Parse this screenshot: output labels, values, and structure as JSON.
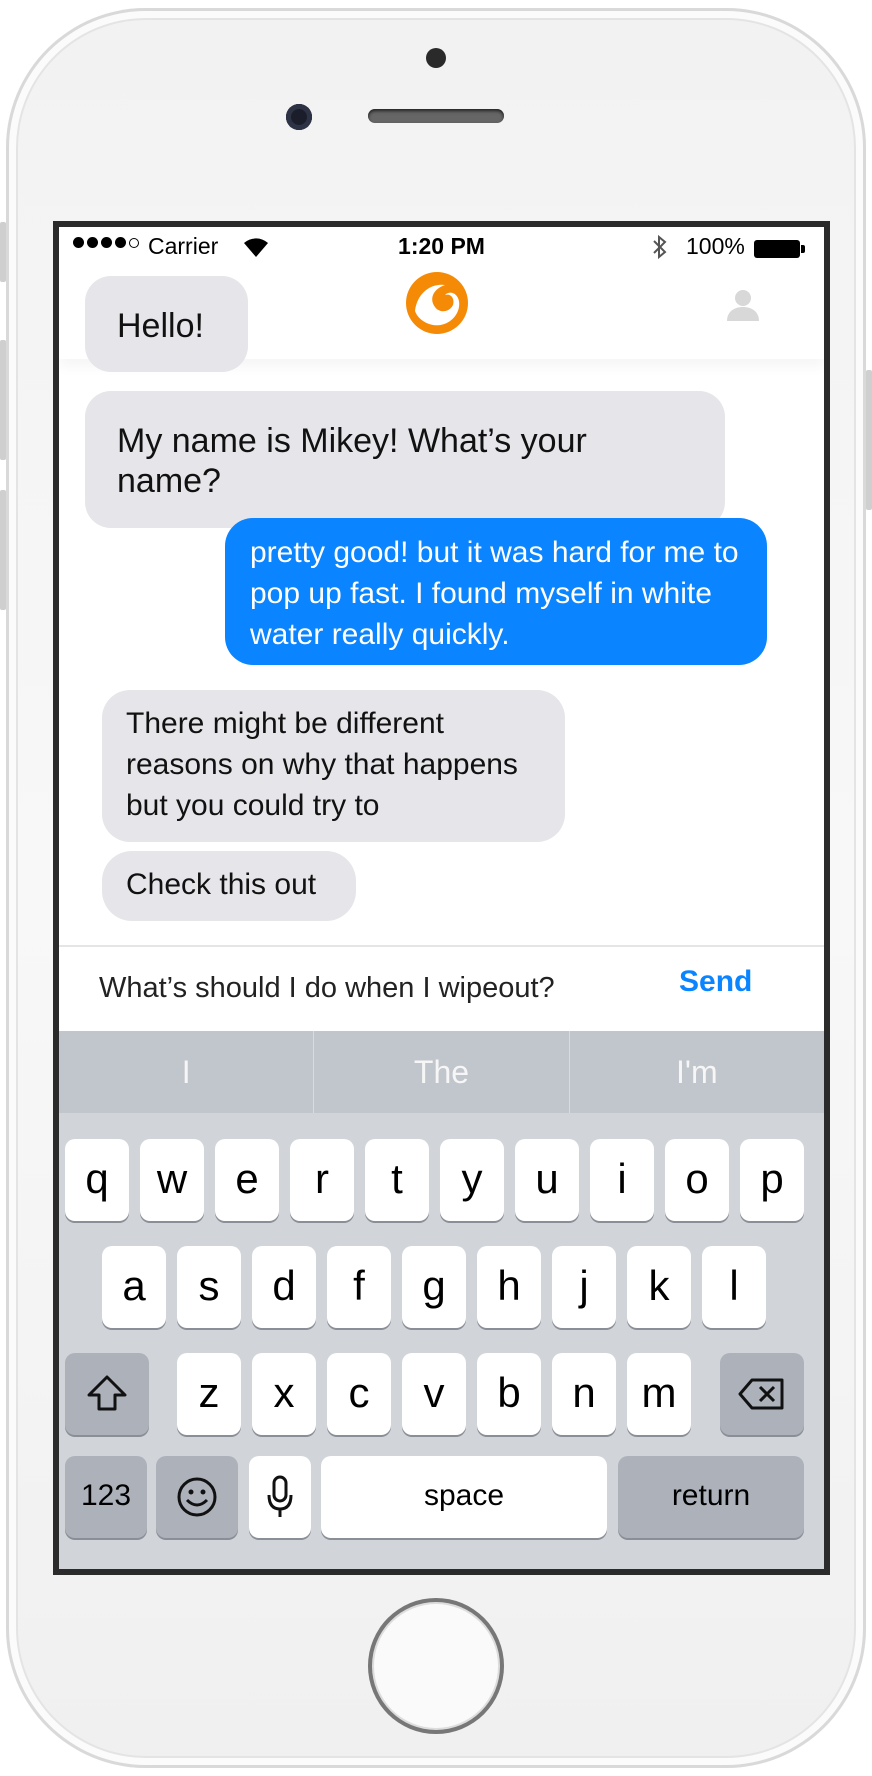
{
  "status_bar": {
    "carrier": "Carrier",
    "time": "1:20 PM",
    "battery": "100%"
  },
  "header": {
    "logo_icon": "wave-logo-icon",
    "profile_icon": "person-icon",
    "accent": "#f58a07"
  },
  "messages": [
    {
      "from": "bot",
      "text": "Hello!"
    },
    {
      "from": "bot",
      "text": "My name is Mikey! What’s your name?"
    },
    {
      "from": "user",
      "text": "pretty good! but it was hard for me to pop up fast. I found myself in white water really quickly."
    },
    {
      "from": "bot",
      "text": "There might be different reasons on why that happens but you could try to"
    },
    {
      "from": "bot",
      "text": "Check this out"
    }
  ],
  "composer": {
    "value": "What’s should I do when I wipeout?",
    "send_label": "Send"
  },
  "keyboard": {
    "suggestions": [
      "I",
      "The",
      "I'm"
    ],
    "row1": [
      "q",
      "w",
      "e",
      "r",
      "t",
      "y",
      "u",
      "i",
      "o",
      "p"
    ],
    "row2": [
      "a",
      "s",
      "d",
      "f",
      "g",
      "h",
      "j",
      "k",
      "l"
    ],
    "row3": [
      "z",
      "x",
      "c",
      "v",
      "b",
      "n",
      "m"
    ],
    "numbers_label": "123",
    "space_label": "space",
    "return_label": "return"
  },
  "colors": {
    "user_bubble": "#0a84ff",
    "bot_bubble": "#e5e5ea",
    "send": "#0a84ff"
  }
}
